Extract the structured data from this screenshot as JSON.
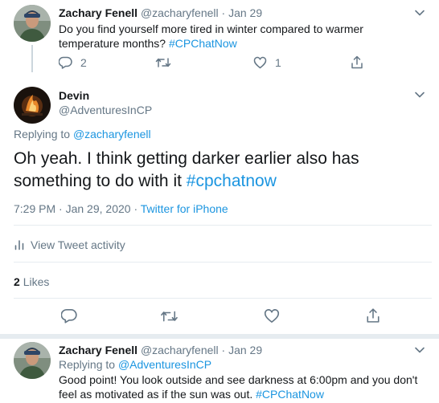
{
  "parent_tweet": {
    "name": "Zachary Fenell",
    "handle": "@zacharyfenell",
    "separator": "·",
    "date": "Jan 29",
    "text": "Do you find yourself more tired in winter compared to warmer temperature months?",
    "hashtag": "#CPChatNow",
    "reply_count": "2",
    "like_count": "1"
  },
  "main_tweet": {
    "name": "Devin",
    "handle": "@AdventuresInCP",
    "replying_prefix": "Replying to",
    "replying_to": "@zacharyfenell",
    "text": "Oh yeah. I think getting darker earlier also has something to do with it",
    "hashtag": "#cpchatnow",
    "time": "7:29 PM",
    "dot": "·",
    "date": "Jan 29, 2020",
    "source": "Twitter for iPhone",
    "activity_label": "View Tweet activity",
    "likes_count": "2",
    "likes_label": "Likes"
  },
  "reply_tweet": {
    "name": "Zachary Fenell",
    "handle": "@zacharyfenell",
    "separator": "·",
    "date": "Jan 29",
    "replying_prefix": "Replying to",
    "replying_to": "@AdventuresInCP",
    "text": "Good point! You look outside and see darkness at 6:00pm and you don't feel as motivated as if the sun was out.",
    "hashtag": "#CPChatNow"
  },
  "icons": {
    "reply": "reply-icon",
    "retweet": "retweet-icon",
    "like": "heart-icon",
    "share": "share-icon",
    "more": "chevron-down-icon",
    "activity": "bar-chart-icon"
  },
  "colors": {
    "link": "#1b95e0",
    "muted": "#657786",
    "text": "#14171a",
    "divider": "#e6ecf0",
    "thread_line": "#ccd6dd"
  }
}
